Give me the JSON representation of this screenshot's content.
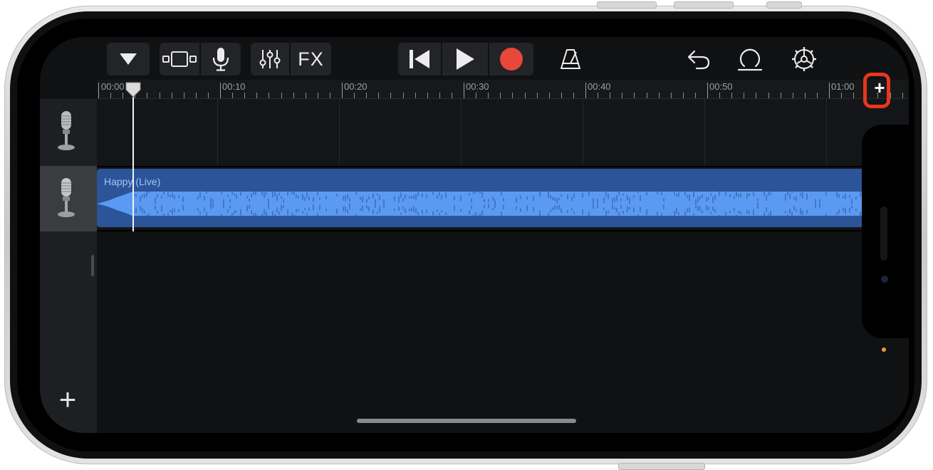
{
  "toolbar": {
    "fx_label": "FX",
    "accent_record": "#e9473a"
  },
  "ruler": {
    "labels": [
      "00:00",
      "00:10",
      "00:20",
      "00:30",
      "00:40",
      "00:50",
      "01:00"
    ]
  },
  "tracks": [
    {
      "icon": "microphone-icon",
      "selected": false,
      "region": null
    },
    {
      "icon": "microphone-icon",
      "selected": true,
      "region": {
        "name": "Happy (Live)"
      }
    }
  ],
  "annotation": {
    "highlight_color": "#e8351f"
  },
  "add_track_symbol": "+",
  "add_section_symbol": "+"
}
